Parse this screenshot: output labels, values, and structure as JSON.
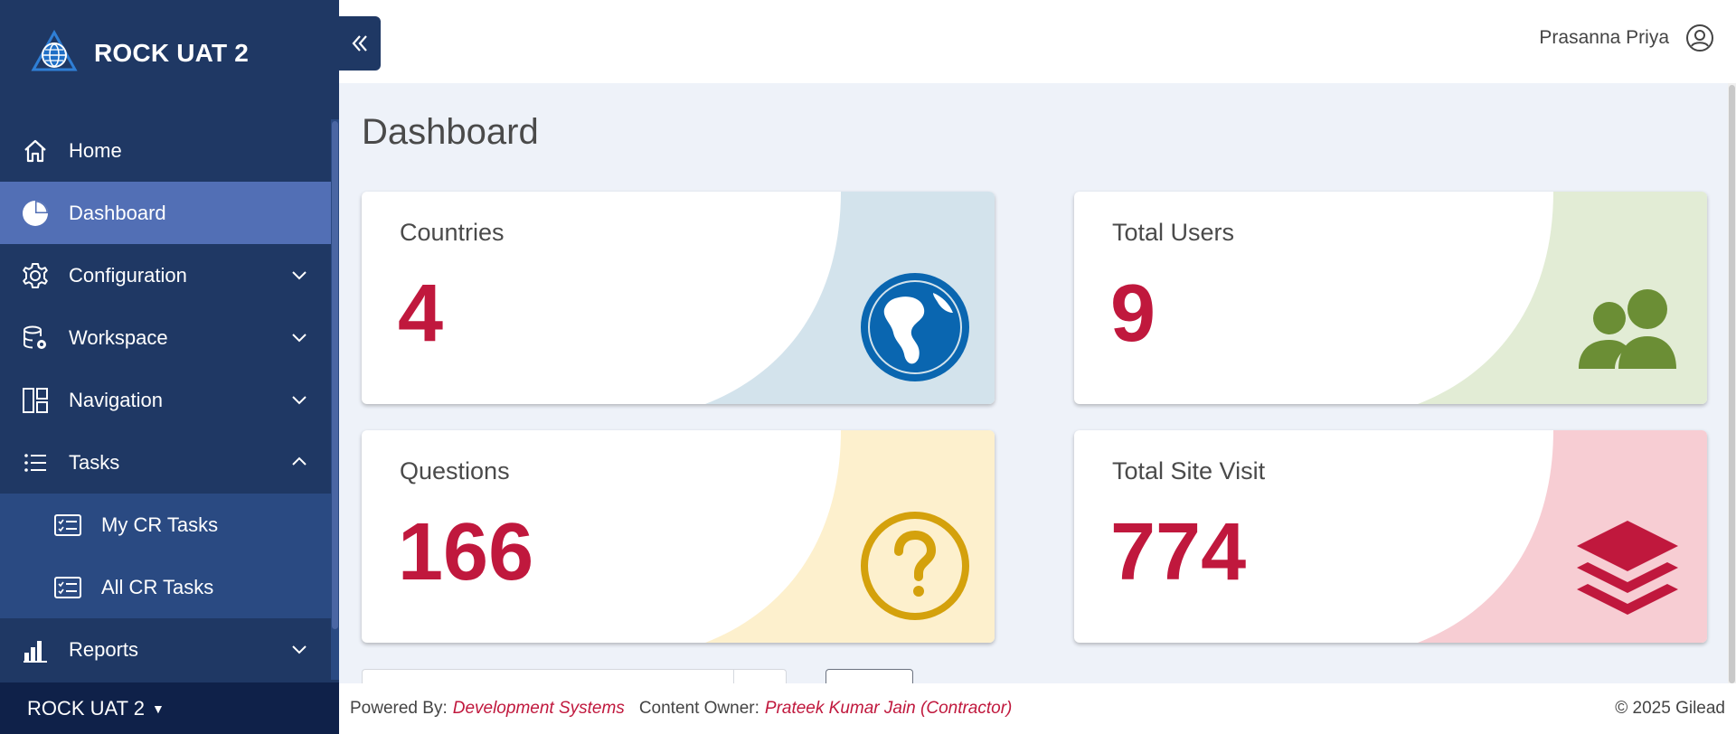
{
  "app": {
    "title": "ROCK UAT 2"
  },
  "sidebar": {
    "items": [
      {
        "label": "Home"
      },
      {
        "label": "Dashboard"
      },
      {
        "label": "Configuration"
      },
      {
        "label": "Workspace"
      },
      {
        "label": "Navigation"
      },
      {
        "label": "Tasks"
      },
      {
        "label": "My CR Tasks"
      },
      {
        "label": "All CR Tasks"
      },
      {
        "label": "Reports"
      }
    ],
    "footer_label": "ROCK UAT 2"
  },
  "header": {
    "user_name": "Prasanna Priya"
  },
  "main": {
    "page_title": "Dashboard",
    "cards": [
      {
        "label": "Countries",
        "value": "4",
        "accent": "#d3e3ec",
        "icon_color": "#0a66b0"
      },
      {
        "label": "Total Users",
        "value": "9",
        "accent": "#e2ecd5",
        "icon_color": "#6b8e35"
      },
      {
        "label": "Questions",
        "value": "166",
        "accent": "#fdf0cd",
        "icon_color": "#d4a10c"
      },
      {
        "label": "Total Site Visit",
        "value": "774",
        "accent": "#f7cdd3",
        "icon_color": "#c0183d"
      }
    ]
  },
  "footer": {
    "powered_by_label": "Powered By:",
    "powered_by_value": "Development Systems",
    "owner_label": "Content Owner:",
    "owner_value": "Prateek Kumar Jain (Contractor)",
    "copyright": "© 2025 Gilead"
  },
  "colors": {
    "sidebar_bg": "#1f3864",
    "sidebar_active": "#526fb5",
    "value_red": "#c0183d"
  }
}
